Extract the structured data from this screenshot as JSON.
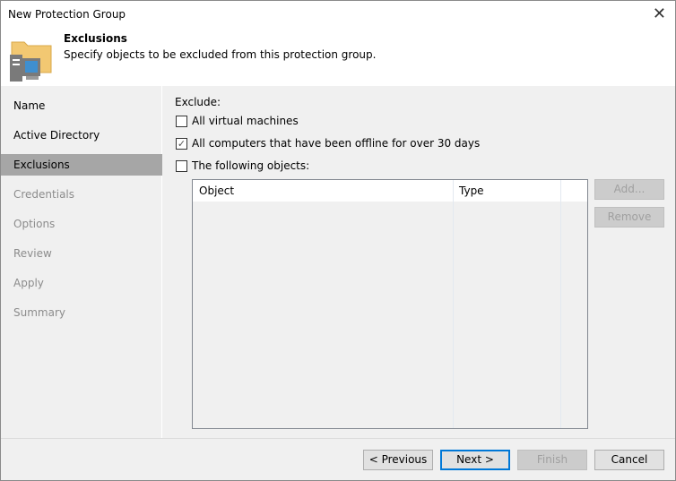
{
  "window": {
    "title": "New Protection Group"
  },
  "header": {
    "title": "Exclusions",
    "subtitle": "Specify objects to be excluded from this protection group."
  },
  "sidebar": {
    "items": [
      {
        "label": "Name"
      },
      {
        "label": "Active Directory"
      },
      {
        "label": "Exclusions",
        "selected": true
      },
      {
        "label": "Credentials"
      },
      {
        "label": "Options"
      },
      {
        "label": "Review"
      },
      {
        "label": "Apply"
      },
      {
        "label": "Summary"
      }
    ]
  },
  "main": {
    "exclude_label": "Exclude:",
    "options": [
      {
        "label": "All virtual machines",
        "checked": false
      },
      {
        "label": "All computers that have been offline for over 30 days",
        "checked": true
      },
      {
        "label": "The following objects:",
        "checked": false
      }
    ],
    "columns": [
      "Object",
      "Type"
    ],
    "add_label": "Add...",
    "remove_label": "Remove"
  },
  "footer": {
    "previous": "< Previous",
    "next": "Next >",
    "finish": "Finish",
    "cancel": "Cancel"
  }
}
